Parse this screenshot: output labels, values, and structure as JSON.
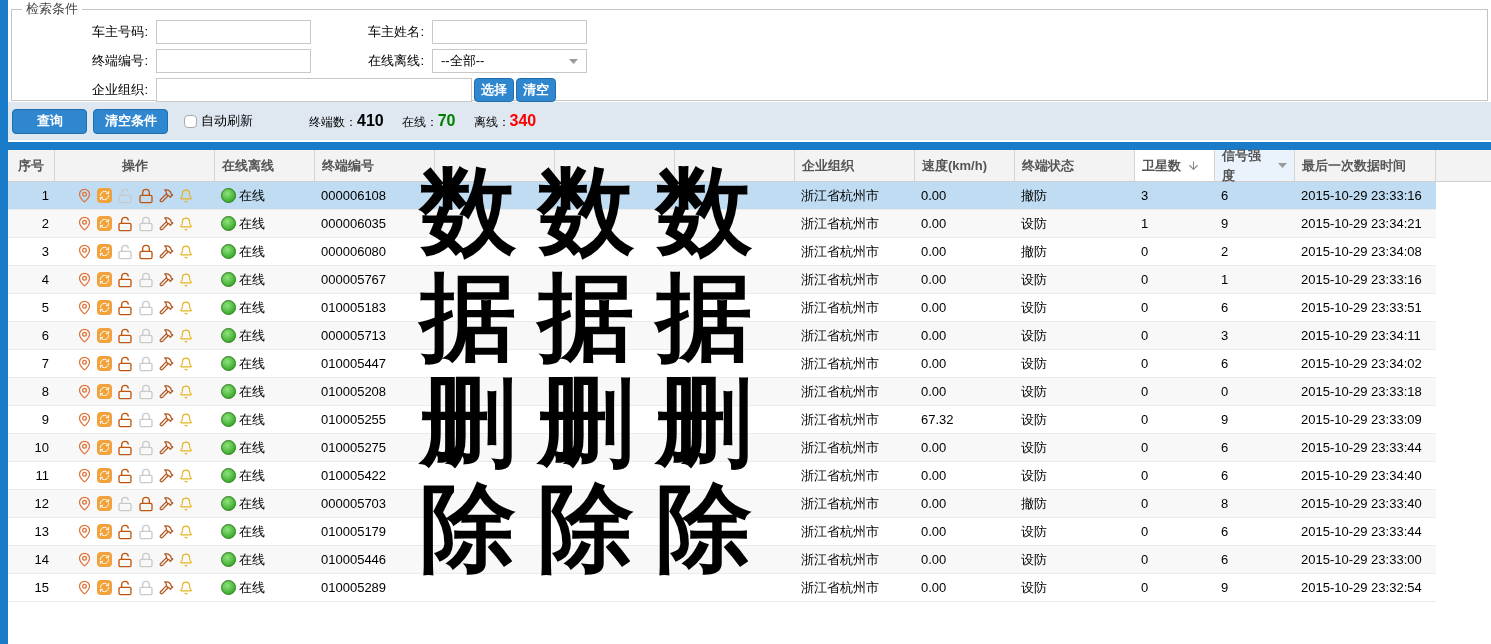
{
  "search_panel": {
    "legend": "检索条件",
    "fields": [
      {
        "label": "车主号码:",
        "kind": "text"
      },
      {
        "label": "车主姓名:",
        "kind": "text"
      },
      {
        "label": "终端编号:",
        "kind": "text"
      },
      {
        "label": "在线离线:",
        "kind": "select",
        "value": "--全部--"
      },
      {
        "label": "企业组织:",
        "kind": "wide",
        "buttons": [
          "选择",
          "清空"
        ]
      }
    ]
  },
  "toolbar": {
    "buttons": [
      "查询",
      "清空条件"
    ],
    "auto_refresh": {
      "label": "自动刷新",
      "checked": false
    },
    "stats": [
      {
        "label": "终端数：",
        "value": "410",
        "color": "#000000"
      },
      {
        "label": "在线：",
        "value": "70",
        "color": "#008000"
      },
      {
        "label": "离线：",
        "value": "340",
        "color": "#ff0000"
      }
    ]
  },
  "table": {
    "columns": [
      {
        "label": "序号"
      },
      {
        "label": "操作"
      },
      {
        "label": "在线离线"
      },
      {
        "label": "终端编号"
      },
      {},
      {},
      {},
      {
        "label": "企业组织"
      },
      {
        "label": "速度(km/h)"
      },
      {
        "label": "终端状态"
      },
      {
        "label": "卫星数",
        "sorted": true
      },
      {
        "label": "信号强度",
        "menu": true
      },
      {
        "label": "最后一次数据时间"
      }
    ],
    "rows": [
      {
        "no": "1",
        "selected": true,
        "locked": true,
        "online": true,
        "status_text": "在线",
        "terminal": "000006108",
        "org": "浙江省杭州市",
        "speed": "0.00",
        "state": "撤防",
        "satellites": "3",
        "signal": "6",
        "time": "2015-10-29 23:33:16"
      },
      {
        "no": "2",
        "selected": false,
        "locked": false,
        "online": true,
        "status_text": "在线",
        "terminal": "000006035",
        "org": "浙江省杭州市",
        "speed": "0.00",
        "state": "设防",
        "satellites": "1",
        "signal": "9",
        "time": "2015-10-29 23:34:21"
      },
      {
        "no": "3",
        "selected": false,
        "locked": true,
        "online": true,
        "status_text": "在线",
        "terminal": "000006080",
        "org": "浙江省杭州市",
        "speed": "0.00",
        "state": "撤防",
        "satellites": "0",
        "signal": "2",
        "time": "2015-10-29 23:34:08"
      },
      {
        "no": "4",
        "selected": false,
        "locked": false,
        "online": true,
        "status_text": "在线",
        "terminal": "000005767",
        "org": "浙江省杭州市",
        "speed": "0.00",
        "state": "设防",
        "satellites": "0",
        "signal": "1",
        "time": "2015-10-29 23:33:16"
      },
      {
        "no": "5",
        "selected": false,
        "locked": false,
        "online": true,
        "status_text": "在线",
        "terminal": "010005183",
        "org": "浙江省杭州市",
        "speed": "0.00",
        "state": "设防",
        "satellites": "0",
        "signal": "6",
        "time": "2015-10-29 23:33:51"
      },
      {
        "no": "6",
        "selected": false,
        "locked": false,
        "online": true,
        "status_text": "在线",
        "terminal": "000005713",
        "org": "浙江省杭州市",
        "speed": "0.00",
        "state": "设防",
        "satellites": "0",
        "signal": "3",
        "time": "2015-10-29 23:34:11"
      },
      {
        "no": "7",
        "selected": false,
        "locked": false,
        "online": true,
        "status_text": "在线",
        "terminal": "010005447",
        "org": "浙江省杭州市",
        "speed": "0.00",
        "state": "设防",
        "satellites": "0",
        "signal": "6",
        "time": "2015-10-29 23:34:02"
      },
      {
        "no": "8",
        "selected": false,
        "locked": false,
        "online": true,
        "status_text": "在线",
        "terminal": "010005208",
        "org": "浙江省杭州市",
        "speed": "0.00",
        "state": "设防",
        "satellites": "0",
        "signal": "0",
        "time": "2015-10-29 23:33:18"
      },
      {
        "no": "9",
        "selected": false,
        "locked": false,
        "online": true,
        "status_text": "在线",
        "terminal": "010005255",
        "org": "浙江省杭州市",
        "speed": "67.32",
        "state": "设防",
        "satellites": "0",
        "signal": "9",
        "time": "2015-10-29 23:33:09"
      },
      {
        "no": "10",
        "selected": false,
        "locked": false,
        "online": true,
        "status_text": "在线",
        "terminal": "010005275",
        "org": "浙江省杭州市",
        "speed": "0.00",
        "state": "设防",
        "satellites": "0",
        "signal": "6",
        "time": "2015-10-29 23:33:44"
      },
      {
        "no": "11",
        "selected": false,
        "locked": false,
        "online": true,
        "status_text": "在线",
        "terminal": "010005422",
        "org": "浙江省杭州市",
        "speed": "0.00",
        "state": "设防",
        "satellites": "0",
        "signal": "6",
        "time": "2015-10-29 23:34:40"
      },
      {
        "no": "12",
        "selected": false,
        "locked": true,
        "online": true,
        "status_text": "在线",
        "terminal": "000005703",
        "org": "浙江省杭州市",
        "speed": "0.00",
        "state": "撤防",
        "satellites": "0",
        "signal": "8",
        "time": "2015-10-29 23:33:40"
      },
      {
        "no": "13",
        "selected": false,
        "locked": false,
        "online": true,
        "status_text": "在线",
        "terminal": "010005179",
        "org": "浙江省杭州市",
        "speed": "0.00",
        "state": "设防",
        "satellites": "0",
        "signal": "6",
        "time": "2015-10-29 23:33:44"
      },
      {
        "no": "14",
        "selected": false,
        "locked": false,
        "online": true,
        "status_text": "在线",
        "terminal": "010005446",
        "org": "浙江省杭州市",
        "speed": "0.00",
        "state": "设防",
        "satellites": "0",
        "signal": "6",
        "time": "2015-10-29 23:33:00"
      },
      {
        "no": "15",
        "selected": false,
        "locked": false,
        "online": true,
        "status_text": "在线",
        "terminal": "010005289",
        "org": "浙江省杭州市",
        "speed": "0.00",
        "state": "设防",
        "satellites": "0",
        "signal": "9",
        "time": "2015-10-29 23:32:54"
      }
    ]
  },
  "redaction_overlay": [
    "数据删除",
    "数据删除",
    "数据删除"
  ]
}
